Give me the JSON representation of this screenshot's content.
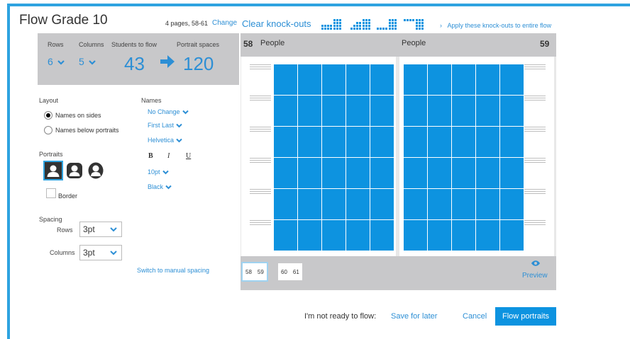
{
  "header": {
    "title": "Flow Grade 10",
    "pages_info": "4 pages, 58-61",
    "change_label": "Change",
    "clear_knockouts_label": "Clear knock-outs",
    "apply_label": "Apply these knock-outs to entire flow",
    "apply_chevron": "›"
  },
  "grid_settings": {
    "rows_label": "Rows",
    "rows_value": "6",
    "columns_label": "Columns",
    "columns_value": "5",
    "students_label": "Students to flow",
    "students_value": "43",
    "spaces_label": "Portrait spaces",
    "spaces_value": "120"
  },
  "layout": {
    "label": "Layout",
    "options": [
      "Names on sides",
      "Names below portraits"
    ],
    "selected": "Names on sides"
  },
  "names": {
    "label": "Names",
    "case": "No Change",
    "order": "First Last",
    "font": "Helvetica",
    "bold": "B",
    "italic": "I",
    "underline": "U",
    "size": "10pt",
    "color": "Black"
  },
  "portraits": {
    "label": "Portraits",
    "border_label": "Border"
  },
  "spacing": {
    "label": "Spacing",
    "rows_label": "Rows",
    "rows_value": "3pt",
    "columns_label": "Columns",
    "columns_value": "3pt",
    "manual_link": "Switch to manual spacing"
  },
  "preview": {
    "left_page_num": "58",
    "left_page_label": "People",
    "right_page_label": "People",
    "right_page_num": "59",
    "thumbs": [
      [
        "58",
        "59"
      ],
      [
        "60",
        "61"
      ]
    ],
    "preview_label": "Preview"
  },
  "footer": {
    "not_ready": "I'm not ready to flow:",
    "save_later": "Save for later",
    "cancel": "Cancel",
    "flow": "Flow portraits"
  },
  "colors": {
    "accent": "#2ea3e0",
    "link": "#2d8fd5",
    "cell": "#0d93e0",
    "panel_grey": "#c8c8ca"
  }
}
